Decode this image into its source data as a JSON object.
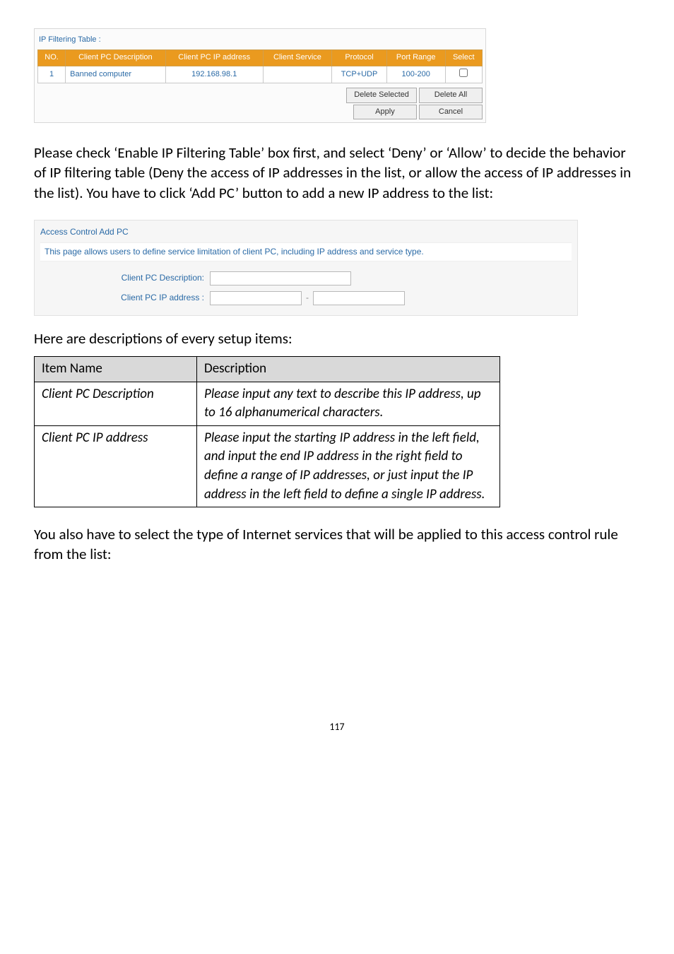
{
  "ipfilter": {
    "caption": "IP Filtering Table :",
    "headers": [
      "NO.",
      "Client PC Description",
      "Client PC IP address",
      "Client Service",
      "Protocol",
      "Port Range",
      "Select"
    ],
    "row": {
      "no": "1",
      "desc": "Banned computer",
      "ip": "192.168.98.1",
      "service": "",
      "protocol": "TCP+UDP",
      "range": "100-200"
    },
    "btn_delete_selected": "Delete Selected",
    "btn_delete_all": "Delete All",
    "btn_apply": "Apply",
    "btn_cancel": "Cancel"
  },
  "para1": "Please check ‘Enable IP Filtering Table’ box first, and select ‘Deny’ or ‘Allow’ to decide the behavior of IP filtering table (Deny the access of IP addresses in the list, or allow the access of IP addresses in the list). You have to click ‘Add PC’ button to add a new IP address to the list:",
  "addpc": {
    "title": "Access Control Add PC",
    "desc": "This page allows users to define service limitation of client PC, including IP address and service type.",
    "label_desc": "Client PC Description:",
    "label_ip": "Client PC IP address :",
    "sep": "-"
  },
  "lead2": "Here are descriptions of every setup items:",
  "table": {
    "h1": "Item Name",
    "h2": "Description",
    "r1c1": "Client PC Description",
    "r1c2": "Please input any text to describe this IP address, up to 16 alphanumerical characters.",
    "r2c1": "Client PC IP address",
    "r2c2": "Please input the starting IP address in the left field, and input the end IP address in the right field to define a range of IP addresses, or just input the IP address in the left field to define a single IP address."
  },
  "para2": "You also have to select the type of Internet services that will be applied to this access control rule from the list:",
  "pagenum": "117"
}
